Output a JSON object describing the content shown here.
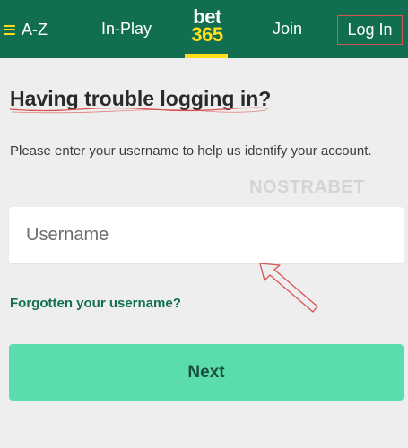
{
  "header": {
    "az_label": "A-Z",
    "inplay_label": "In-Play",
    "logo_top": "bet",
    "logo_bottom": "365",
    "join_label": "Join",
    "login_label": "Log In"
  },
  "main": {
    "title": "Having trouble logging in?",
    "description": "Please enter your username to help us identify your account.",
    "watermark": "NOSTRABET",
    "username_placeholder": "Username",
    "username_value": "",
    "forgot_link": "Forgotten your username?",
    "next_label": "Next"
  },
  "colors": {
    "header_bg": "#126e51",
    "brand_yellow": "#ffdf1b",
    "next_button_bg": "#5adcad",
    "link_green": "#126e51",
    "annotation_red": "#d9534f"
  },
  "icons": {
    "menu": "hamburger-icon",
    "annotation": "arrow-annotation-icon"
  }
}
